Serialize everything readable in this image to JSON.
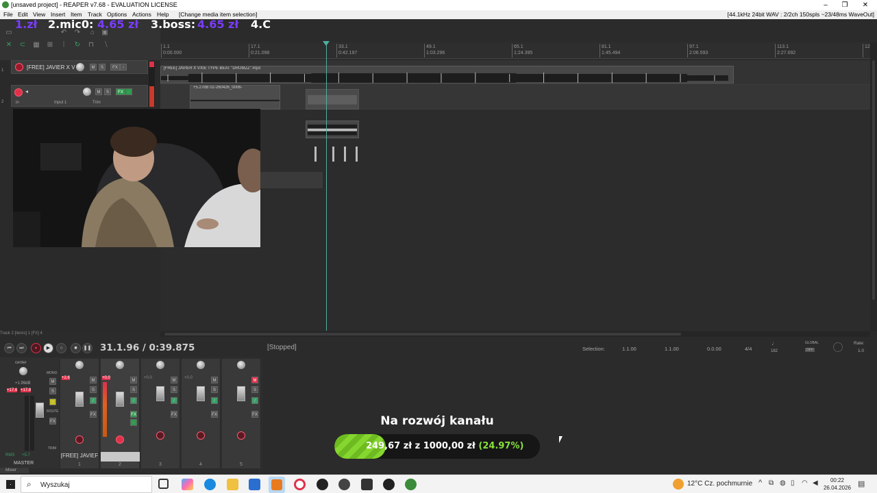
{
  "window": {
    "title": "[unsaved project] - REAPER v7.68 - EVALUATION LICENSE",
    "controls": [
      "–",
      "❐",
      "✕"
    ]
  },
  "menu": {
    "items": [
      "File",
      "Edit",
      "View",
      "Insert",
      "Item",
      "Track",
      "Options",
      "Actions",
      "Help"
    ],
    "context": "[Change media item selection]",
    "status": "[44.1kHz 24bit WAV : 2/2ch 150spls ~23/48ms WaveOut]"
  },
  "overlay_top": {
    "entries": [
      {
        "label": "1.zł",
        "amount": ""
      },
      {
        "label": "2.mic0:",
        "amount": "4.65 zł"
      },
      {
        "label": "3.boss:",
        "amount": "4.65 zł"
      },
      {
        "label": "4.C",
        "amount": ""
      }
    ]
  },
  "ruler": {
    "marks": [
      {
        "bar": "1.1",
        "time": "0:00.000"
      },
      {
        "bar": "17.1",
        "time": "0:21.098"
      },
      {
        "bar": "33.1",
        "time": "0:42.197"
      },
      {
        "bar": "49.1",
        "time": "1:03.296"
      },
      {
        "bar": "65.1",
        "time": "1:24.395"
      },
      {
        "bar": "81.1",
        "time": "1:45.494"
      },
      {
        "bar": "97.1",
        "time": "2:06.593"
      },
      {
        "bar": "113.1",
        "time": "2:27.692"
      },
      {
        "bar": "129.1",
        "time": ""
      }
    ]
  },
  "tracks": [
    {
      "number": "1",
      "name": "[FREE] JAVIER X V",
      "buttons": [
        "M",
        "S",
        "FX"
      ]
    },
    {
      "number": "2",
      "name": "",
      "input": "Input 1",
      "in_label": "in",
      "trim": "Trim",
      "buttons": [
        "M",
        "S",
        "FX"
      ]
    }
  ],
  "items": {
    "beat": {
      "label": "[FREE] JAVIER X VXIE TYPE BEAT \"DRUMZZ\".mp3",
      "flags": "M FX"
    },
    "rec": {
      "label": "+5.27dB 02-260426_0006-",
      "flags": "M FX"
    }
  },
  "status_line": "Track 2 [items] 1 [FX] 4",
  "transport": {
    "time": "31.1.96 / 0:39.875",
    "state": "[Stopped]",
    "selection_label": "Selection:",
    "sel_start": "1.1.00",
    "sel_end": "1.1.00",
    "sel_len": "0.0.00",
    "time_sig": "4/4",
    "bpm": "182",
    "global": "GLOBAL",
    "global_state": "OFF",
    "rate_label": "Rate:",
    "rate": "1.0"
  },
  "mixer": {
    "master": {
      "pan": "center",
      "vol": "+1.99dB",
      "peak_l": "+17.6",
      "peak_r": "+17.8",
      "rms_label": "RMS",
      "rms": "+5.7",
      "label": "MASTER",
      "mono": "MONO",
      "route": "ROUTE",
      "trim": "TRIM"
    },
    "strips": [
      {
        "num": "1",
        "name": "[FREE] JAVIEF",
        "peak": "+2.6",
        "fx_active": false,
        "mute_active": false
      },
      {
        "num": "2",
        "name": "",
        "peak": "+0.0",
        "fx_active": true,
        "mute_active": false
      },
      {
        "num": "3",
        "name": "",
        "peak": "+0.0",
        "fx_active": false,
        "mute_active": false
      },
      {
        "num": "4",
        "name": "",
        "peak": "+0.0",
        "fx_active": false,
        "mute_active": false
      },
      {
        "num": "5",
        "name": "",
        "peak": "",
        "fx_active": false,
        "mute_active": true
      }
    ],
    "tab": "Mixer"
  },
  "goal": {
    "title": "Na rozwój kanału",
    "current": "249,67 zł",
    "sep": "z",
    "target": "1000,00 zł",
    "percent": "(24.97%)",
    "fraction": 0.2497
  },
  "taskbar": {
    "search_placeholder": "Wyszukaj",
    "weather": "12°C  Cz. pochmurnie",
    "time": "00:22",
    "date": "26.04.2026"
  },
  "colors": {
    "accent": "#4fb0a0",
    "goal_green": "#86d630",
    "donation_purple": "#7a3cff",
    "record_red": "#e0304a"
  }
}
